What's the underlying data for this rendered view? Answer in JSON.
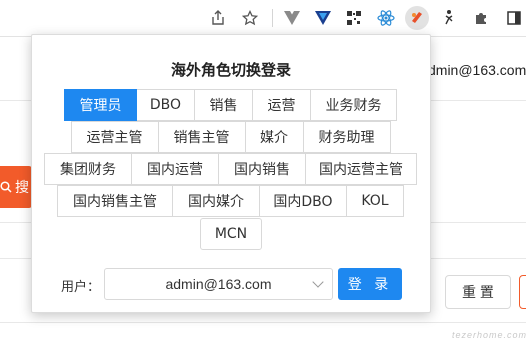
{
  "toolbar": {
    "icons": [
      "share-icon",
      "star-icon",
      "vue-devtools-icon",
      "heart-shield-icon",
      "qr-code-icon",
      "react-icon",
      "active-extension-icon",
      "puzzle-icon",
      "sidebar-icon"
    ]
  },
  "background": {
    "email": "dmin@163.com",
    "search_label": "搜",
    "reset_label": "重 置",
    "watermark": "tezerhome.com"
  },
  "popup": {
    "title": "海外角色切换登录",
    "roles": [
      [
        "管理员",
        "DBO",
        "销售",
        "运营",
        "业务财务"
      ],
      [
        "运营主管",
        "销售主管",
        "媒介",
        "财务助理"
      ],
      [
        "集团财务",
        "国内运营",
        "国内销售",
        "国内运营主管"
      ],
      [
        "国内销售主管",
        "国内媒介",
        "国内DBO",
        "KOL"
      ],
      [
        "MCN"
      ]
    ],
    "selected_role": "管理员",
    "user_label": "用户：",
    "user_value": "admin@163.com",
    "login_label": "登 录"
  },
  "colors": {
    "accent": "#1e88f0",
    "brand_orange": "#f25b2a"
  }
}
